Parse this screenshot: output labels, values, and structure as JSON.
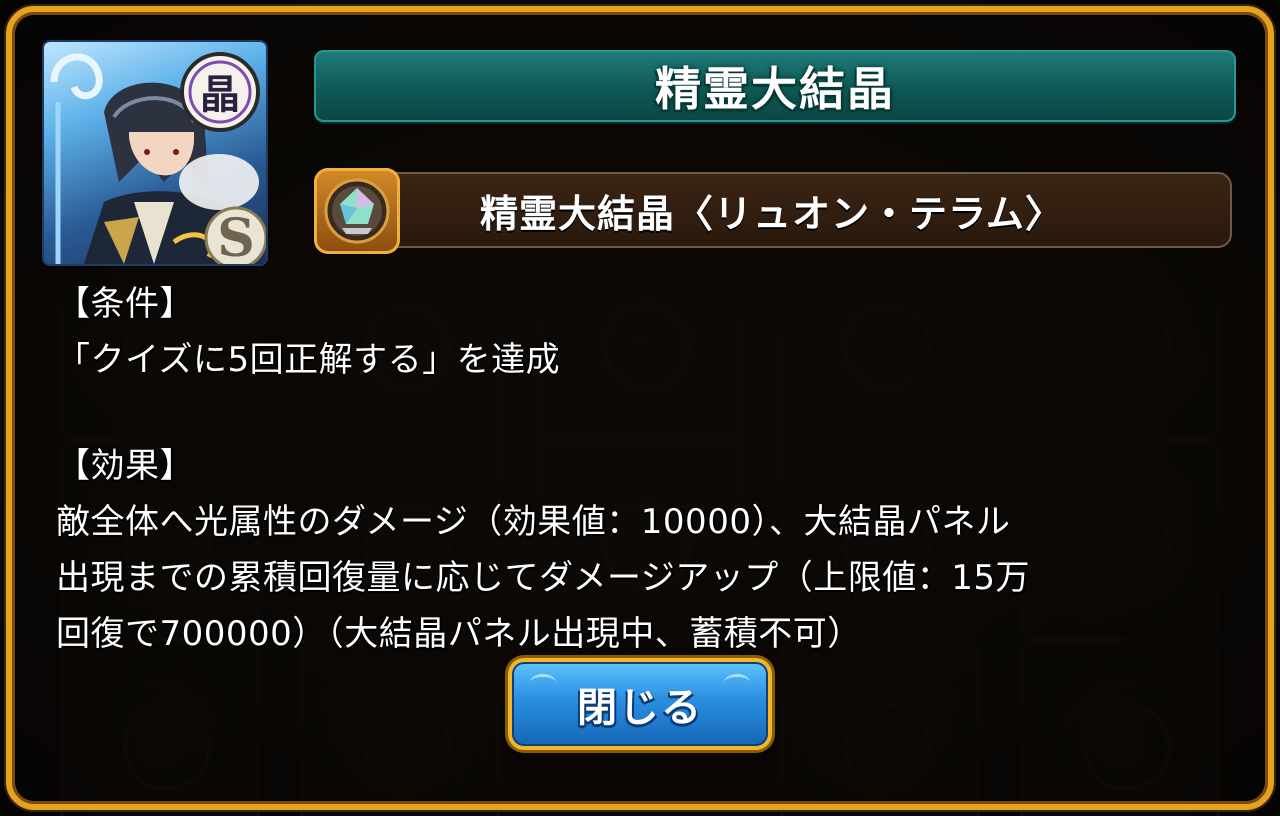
{
  "header": {
    "title": "精霊大結晶"
  },
  "crystal": {
    "name": "精霊大結晶〈リュオン・テラム〉",
    "icon": "crystal-gem-icon",
    "badge_color": "#d48a2a"
  },
  "card": {
    "icon": "character-card-icon",
    "rank": "S",
    "element_glyph": "晶"
  },
  "condition": {
    "heading": "【条件】",
    "text": "「クイズに5回正解する」を達成"
  },
  "effect": {
    "heading": "【効果】",
    "lines": [
      "敵全体へ光属性のダメージ（効果値：10000）、大結晶パネル",
      "出現までの累積回復量に応じてダメージアップ（上限値：15万",
      "回復で700000）（大結晶パネル出現中、蓄積不可）"
    ]
  },
  "close_button": {
    "label": "閉じる"
  },
  "colors": {
    "frame_border": "#e6a21c",
    "title_bar": "#0f5956",
    "button": "#2a8ee0"
  }
}
